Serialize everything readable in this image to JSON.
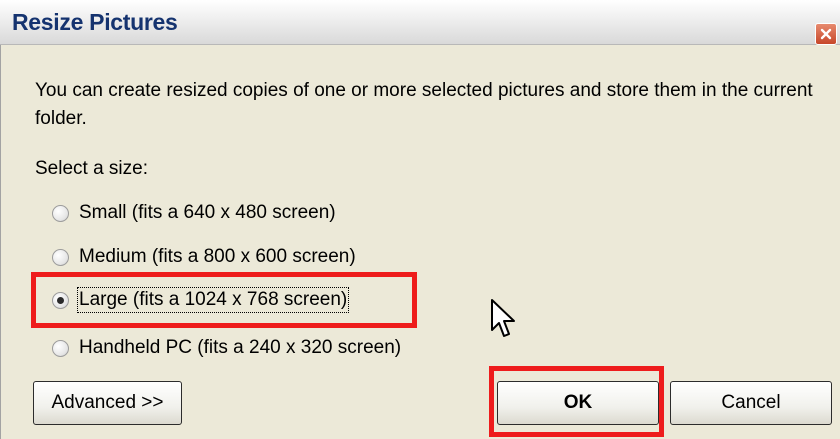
{
  "dialog": {
    "title": "Resize Pictures",
    "description": "You can create resized copies of one or more selected pictures and store them in the current folder.",
    "select_label": "Select a size:",
    "options": [
      {
        "label": "Small (fits a 640 x 480 screen)",
        "checked": false
      },
      {
        "label": "Medium (fits a 800 x 600 screen)",
        "checked": false
      },
      {
        "label": "Large (fits a 1024 x 768 screen)",
        "checked": true
      },
      {
        "label": "Handheld PC (fits a 240 x 320 screen)",
        "checked": false
      }
    ],
    "buttons": {
      "advanced": "Advanced >>",
      "ok": "OK",
      "cancel": "Cancel"
    }
  },
  "icons": {
    "close": "close-icon",
    "cursor": "mouse-pointer-icon"
  },
  "colors": {
    "highlight": "#ee1c1c",
    "title": "#15336f",
    "dialog_bg": "#ece9d8"
  }
}
